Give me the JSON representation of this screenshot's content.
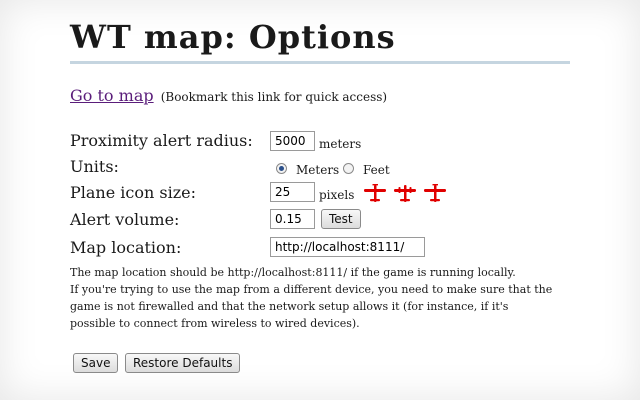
{
  "page": {
    "title": "WT map: Options"
  },
  "goto": {
    "link_text": "Go to map",
    "hint": "(Bookmark this link for quick access)"
  },
  "form": {
    "proximity": {
      "label": "Proximity alert radius:",
      "value": "5000",
      "unit": "meters"
    },
    "units": {
      "label": "Units:",
      "options": [
        {
          "label": "Meters",
          "checked": true
        },
        {
          "label": "Feet",
          "checked": false
        }
      ]
    },
    "plane_icon_size": {
      "label": "Plane icon size:",
      "value": "25",
      "unit": "pixels"
    },
    "alert_volume": {
      "label": "Alert volume:",
      "value": "0.15",
      "test_label": "Test"
    },
    "map_location": {
      "label": "Map location:",
      "value": "http://localhost:8111/"
    }
  },
  "note": {
    "line1": "The map location should be http://localhost:8111/ if the game is running locally.",
    "line2": "If you're trying to use the map from a different device, you need to make sure that the",
    "line3": "game is not firewalled and that the network setup allows it (for instance, if it's",
    "line4": "possible to connect from wireless to wired devices)."
  },
  "actions": {
    "save_label": "Save",
    "restore_label": "Restore Defaults"
  },
  "colors": {
    "plane_icon": "#e00000",
    "link": "#5a1d7a",
    "title_rule": "#c5d5e0"
  }
}
